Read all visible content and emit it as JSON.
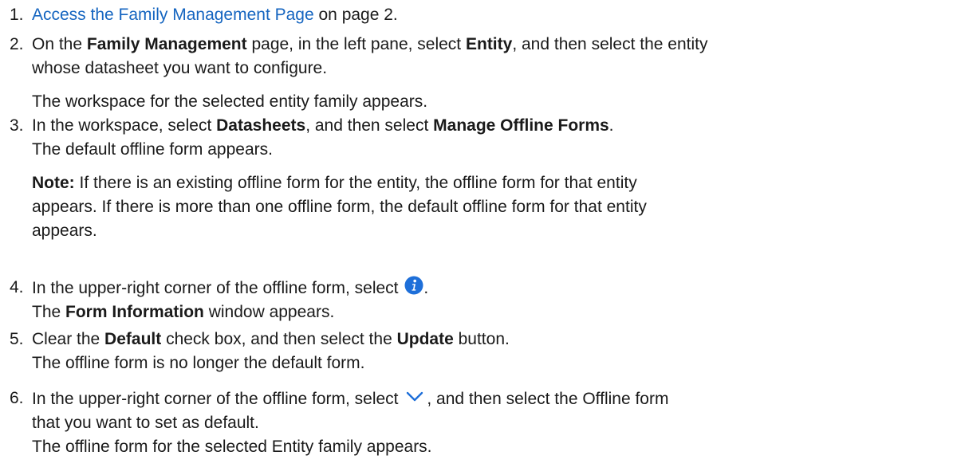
{
  "colors": {
    "link": "#1565c0",
    "icon": "#1e6fd9",
    "text": "#1a1a1a"
  },
  "icons": {
    "info": "info-icon",
    "chevron": "chevron-down-icon"
  },
  "steps": [
    {
      "number": "1.",
      "link_text": "Access the Family Management Page",
      "after_link": " on page 2."
    },
    {
      "number": "2.",
      "p1": "On the ",
      "b1": "Family Management",
      "p2": " page, in the left pane, select ",
      "b2": "Entity",
      "p3": ", and then select the entity",
      "line2": "whose datasheet you want to configure.",
      "result": "The workspace for the selected entity family appears."
    },
    {
      "number": "3.",
      "p1": "In the workspace, select ",
      "b1": "Datasheets",
      "p2": ", and then select ",
      "b2": "Manage Offline Forms",
      "p3": ".",
      "result": "The default offline form appears.",
      "note_label": "Note:",
      "note_line1": " If there is an existing offline form for the entity, the offline form for that entity",
      "note_line2": "appears. If there is more than one offline form, the default offline form for that entity",
      "note_line3": "appears."
    },
    {
      "number": "4.",
      "p1": "In the upper-right corner of the offline form, select ",
      "p2": ".",
      "r1": "The ",
      "rb": "Form Information",
      "r2": " window appears."
    },
    {
      "number": "5.",
      "p1": "Clear the ",
      "b1": "Default",
      "p2": " check box, and then select the ",
      "b2": "Update",
      "p3": " button.",
      "result": "The offline form is no longer the default form."
    },
    {
      "number": "6.",
      "p1": "In the upper-right corner of the offline form, select ",
      "p2": ", and then select the Offline form",
      "line2": "that you want to set as default.",
      "result": "The offline form for the selected Entity family appears."
    }
  ]
}
